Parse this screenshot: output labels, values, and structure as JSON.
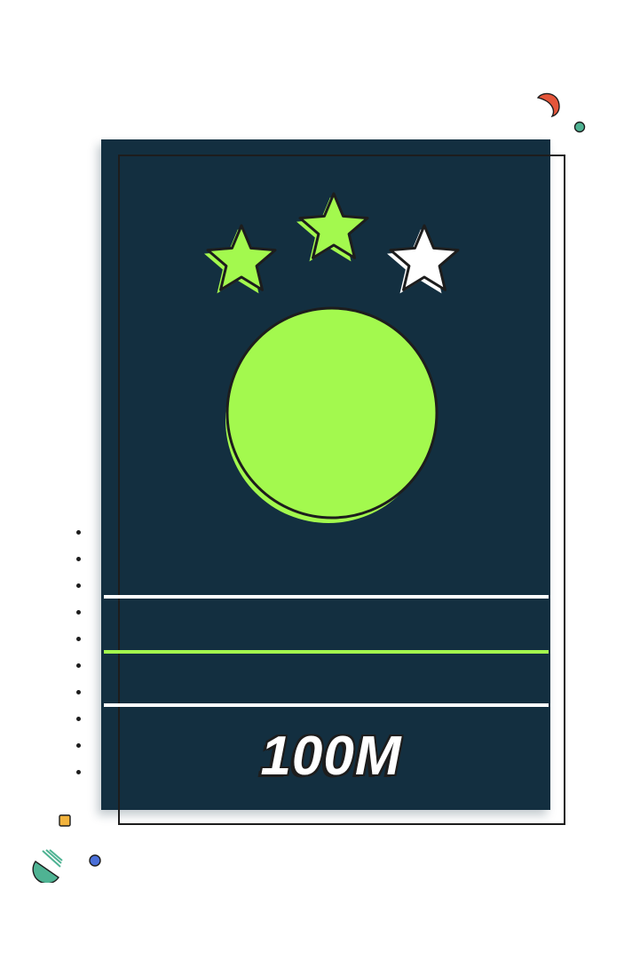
{
  "poster": {
    "distance_label": "100M",
    "rating": {
      "filled": 2,
      "total": 3
    }
  },
  "colors": {
    "card_background": "#132f40",
    "accent_green": "#a3f94e",
    "outline": "#1d1d1d",
    "white": "#ffffff",
    "deco_red": "#e4553a",
    "deco_teal": "#4fb393",
    "deco_yellow": "#f2b33d",
    "deco_blue": "#4a6fd8"
  },
  "icons": {
    "star_filled": "star-filled-icon",
    "star_empty": "star-empty-icon",
    "ball": "tennis-ball-icon"
  }
}
